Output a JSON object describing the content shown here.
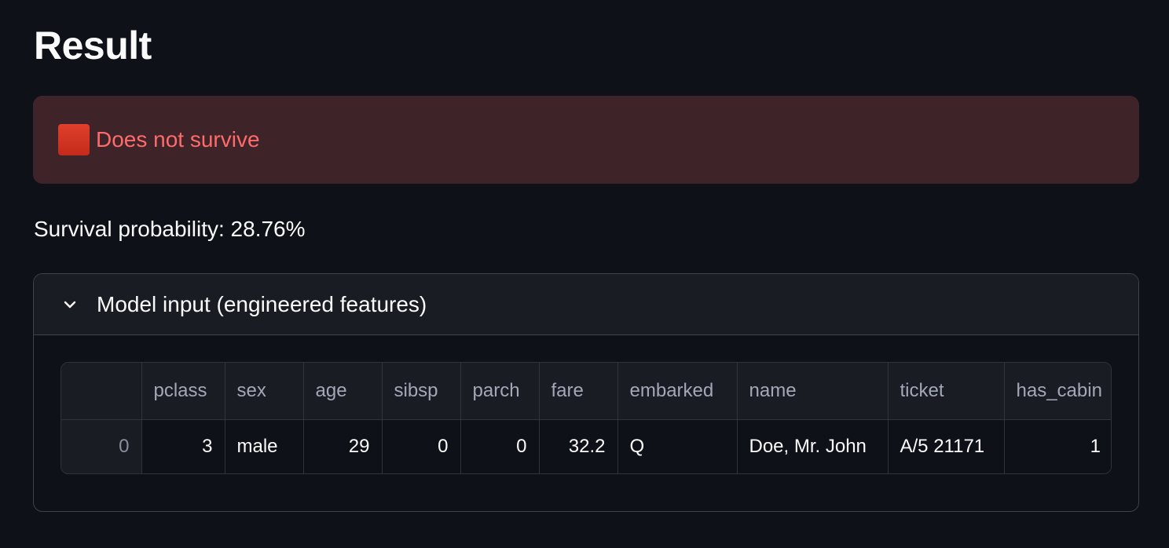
{
  "page": {
    "title": "Result"
  },
  "alert": {
    "icon": "red-square-icon",
    "text": "Does not survive",
    "color": "#ff6b6b"
  },
  "probability_text": "Survival probability: 28.76%",
  "expander": {
    "label": "Model input (engineered features)",
    "expanded": true,
    "icon": "chevron-down-icon"
  },
  "table": {
    "columns": [
      "",
      "pclass",
      "sex",
      "age",
      "sibsp",
      "parch",
      "fare",
      "embarked",
      "name",
      "ticket",
      "has_cabin"
    ],
    "rows": [
      [
        "0",
        "3",
        "male",
        "29",
        "0",
        "0",
        "32.2",
        "Q",
        "Doe, Mr. John",
        "A/5 21171",
        "1"
      ]
    ]
  }
}
